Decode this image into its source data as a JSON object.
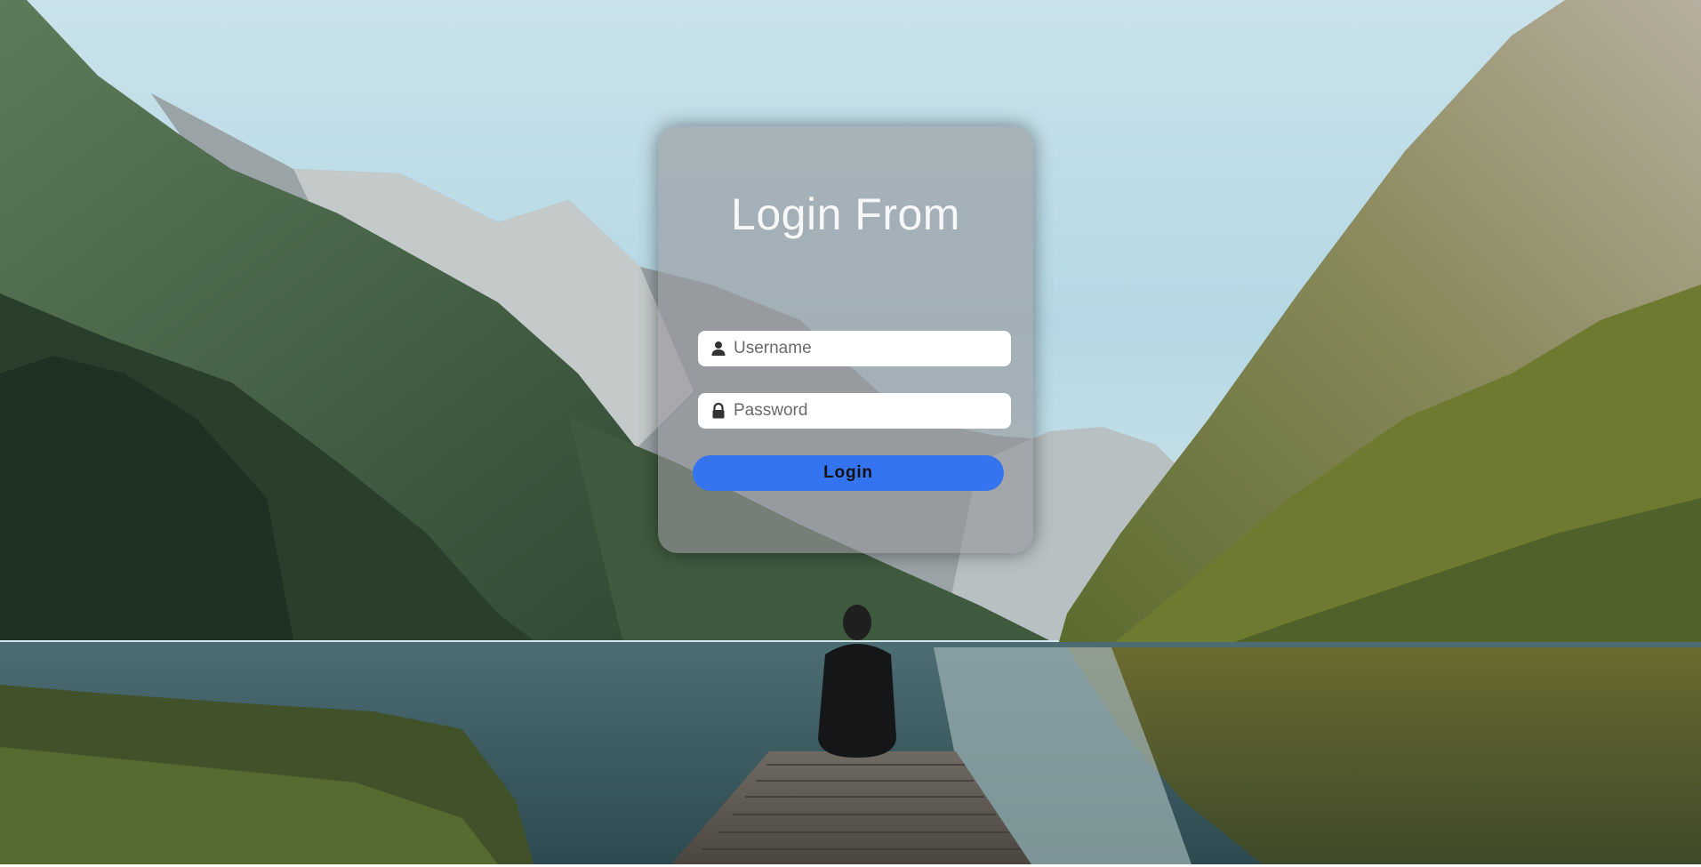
{
  "login": {
    "title": "Login From",
    "username_placeholder": "Username",
    "password_placeholder": "Password",
    "button_label": "Login"
  },
  "icons": {
    "username": "user-icon",
    "password": "lock-icon"
  },
  "colors": {
    "button": "#3574f0",
    "card": "rgba(150,150,155,0.62)",
    "title": "#f7f7f7"
  }
}
